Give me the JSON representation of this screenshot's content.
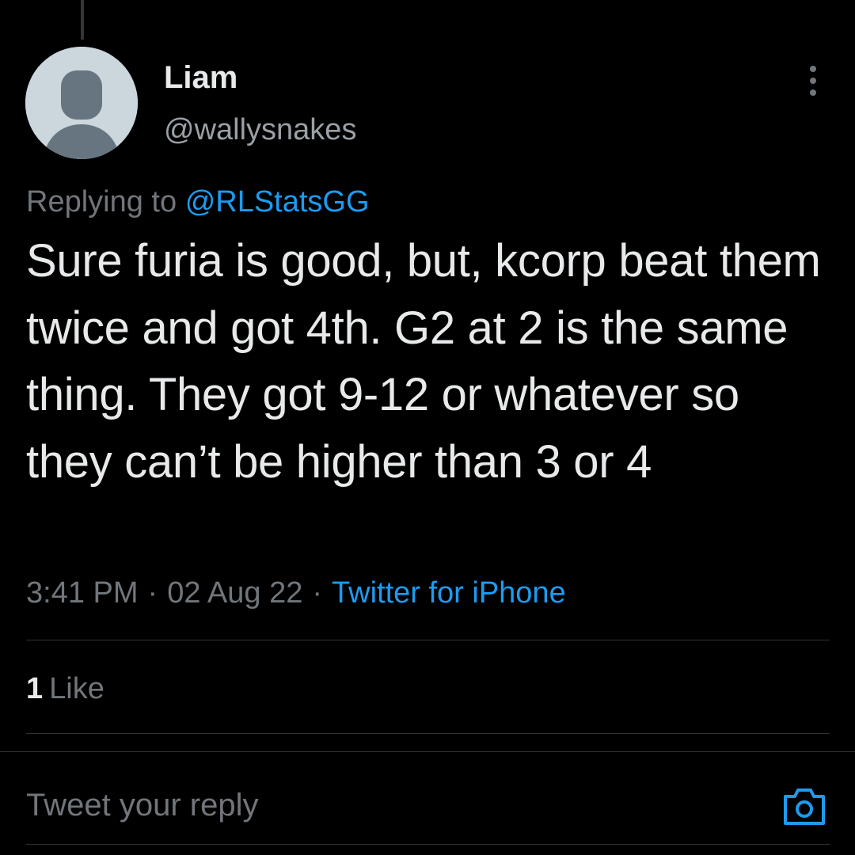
{
  "tweet": {
    "author": {
      "display_name": "Liam",
      "handle": "@wallysnakes",
      "avatar_icon": "default-avatar-icon"
    },
    "replying_to": {
      "prefix": "Replying to",
      "mention": "@RLStatsGG"
    },
    "text": "Sure furia is good, but, kcorp beat them twice and got 4th. G2 at 2 is the same thing. They got 9-12 or whatever so they can’t be higher than 3 or 4",
    "time": "3:41 PM",
    "date": "02 Aug 22",
    "separator": "·",
    "source": "Twitter for iPhone",
    "likes": {
      "count": "1",
      "label": "Like"
    }
  },
  "reply_composer": {
    "placeholder": "Tweet your reply",
    "camera_icon": "camera-icon"
  },
  "colors": {
    "background": "#000000",
    "text": "#e7e9ea",
    "secondary": "#71767b",
    "accent": "#1d9bf0",
    "divider": "#2f3336"
  }
}
